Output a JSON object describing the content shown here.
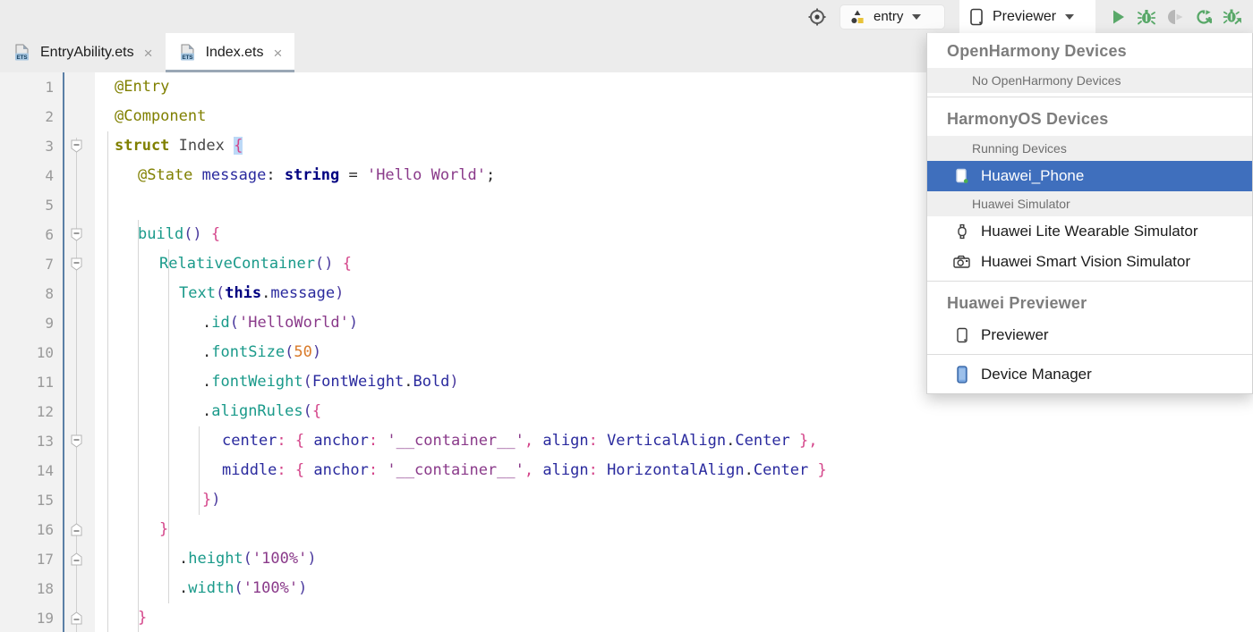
{
  "toolbar": {
    "locate_icon": "crosshair-target-icon",
    "module_chip": {
      "label": "entry",
      "icon": "module-shapes-icon",
      "caret": "chevron-down-icon"
    },
    "device_chip": {
      "label": "Previewer",
      "icon": "phone-outline-icon",
      "caret": "chevron-down-icon"
    },
    "actions": [
      {
        "name": "run-button",
        "icon": "play-triangle-icon",
        "color": "#59a869",
        "enabled": true
      },
      {
        "name": "debug-button",
        "icon": "bug-icon",
        "color": "#59a869",
        "enabled": true
      },
      {
        "name": "profile-button",
        "icon": "profile-run-icon",
        "color": "#b0b0b0",
        "enabled": false
      },
      {
        "name": "rerun-button",
        "icon": "refresh-arrow-icon",
        "color": "#59a869",
        "enabled": true
      },
      {
        "name": "attach-debugger-button",
        "icon": "bug-attach-icon",
        "color": "#59a869",
        "enabled": true
      }
    ]
  },
  "tabs": [
    {
      "label": "EntryAbility.ets",
      "icon": "ets-file-icon",
      "selected": false,
      "close": "×"
    },
    {
      "label": "Index.ets",
      "icon": "ets-file-icon",
      "selected": true,
      "close": "×"
    }
  ],
  "editor": {
    "line_numbers": [
      "1",
      "2",
      "3",
      "4",
      "5",
      "6",
      "7",
      "8",
      "9",
      "10",
      "11",
      "12",
      "13",
      "14",
      "15",
      "16",
      "17",
      "18",
      "19"
    ],
    "lines": [
      "@Entry",
      "@Component",
      "struct Index {",
      "  @State message: string = 'Hello World';",
      "",
      "  build() {",
      "    RelativeContainer() {",
      "      Text(this.message)",
      "        .id('HelloWorld')",
      "        .fontSize(50)",
      "        .fontWeight(FontWeight.Bold)",
      "        .alignRules({",
      "          center: { anchor: '__container__', align: VerticalAlign.Center },",
      "          middle: { anchor: '__container__', align: HorizontalAlign.Center }",
      "        })",
      "      }",
      "      .height('100%')",
      "      .width('100%')",
      "  }"
    ],
    "fold_markers": [
      {
        "line": 3,
        "type": "collapse"
      },
      {
        "line": 6,
        "type": "collapse"
      },
      {
        "line": 7,
        "type": "collapse"
      },
      {
        "line": 12,
        "type": "collapse"
      },
      {
        "line": 15,
        "type": "end"
      },
      {
        "line": 16,
        "type": "end"
      },
      {
        "line": 19,
        "type": "end"
      }
    ]
  },
  "dropdown": {
    "sections": [
      {
        "title": "OpenHarmony Devices",
        "subheader": "No OpenHarmony Devices",
        "items": []
      },
      {
        "title": "HarmonyOS Devices",
        "subheader": "Running Devices",
        "items": [
          {
            "label": "Huawei_Phone",
            "icon": "phone-running-icon",
            "selected": true
          },
          {
            "label": "Huawei Lite Wearable Simulator",
            "icon": "watch-icon",
            "selected": false
          },
          {
            "label": "Huawei Smart Vision Simulator",
            "icon": "camera-icon",
            "selected": false
          }
        ],
        "subheader2": "Huawei Simulator"
      },
      {
        "title": "Huawei Previewer",
        "items": [
          {
            "label": "Previewer",
            "icon": "phone-outline-icon",
            "selected": false
          }
        ]
      },
      {
        "title": "",
        "items": [
          {
            "label": "Device Manager",
            "icon": "device-manager-phone-icon",
            "selected": false
          }
        ]
      }
    ]
  },
  "colors": {
    "accent_selection": "#3f6fbd",
    "run_green": "#59a869",
    "disabled_grey": "#b0b0b0",
    "toolbar_bg": "#ececec",
    "gutter_bg": "#f2f2f2"
  }
}
